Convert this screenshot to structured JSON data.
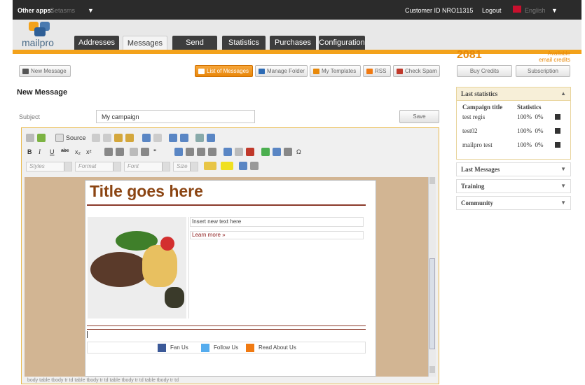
{
  "topbar": {
    "other_apps_label": "Other apps:",
    "other_apps_value": "Getasms",
    "customer_id": "Customer ID NRO11315",
    "logout": "Logout",
    "language": "English"
  },
  "logo": {
    "text": "mailpro"
  },
  "tabs": [
    {
      "label": "Addresses"
    },
    {
      "label": "Messages"
    },
    {
      "label": "Send"
    },
    {
      "label": "Statistics"
    },
    {
      "label": "Purchases"
    },
    {
      "label": "Configuration"
    }
  ],
  "toolbar": {
    "new_message": "New Message",
    "list_of_messages": "List of Messages",
    "manage_folder": "Manage Folder",
    "my_templates": "My Templates",
    "rss": "RSS",
    "check_spam": "Check Spam"
  },
  "credits": {
    "value": "2081",
    "label_line1": "Available",
    "label_line2": "email credits",
    "buy": "Buy Credits",
    "subscription": "Subscription"
  },
  "form": {
    "section_title": "New Message",
    "subject_label": "Subject",
    "subject_value": "My campaign",
    "save": "Save"
  },
  "editor": {
    "source_label": "Source",
    "styles": "Styles",
    "format": "Format",
    "font": "Font",
    "size": "Size",
    "template": {
      "title": "Title goes here",
      "insert_text": "Insert new text here",
      "learn_more": "Learn more »",
      "fan_us": "Fan Us",
      "follow_us": "Follow Us",
      "read_about_us": "Read About Us"
    },
    "path": "body  table  tbody  tr  td  table  tbody  tr  td  table  tbody  tr  td  table  tbody  tr  td"
  },
  "sidebar": {
    "last_statistics": "Last statistics",
    "col_campaign": "Campaign title",
    "col_statistics": "Statistics",
    "rows": [
      {
        "title": "test regis",
        "stats": "100%  0%"
      },
      {
        "title": "test02",
        "stats": "100%  0%"
      },
      {
        "title": "mailpro test",
        "stats": "100%  0%"
      }
    ],
    "last_messages": "Last Messages",
    "training": "Training",
    "community": "Community"
  },
  "colors": {
    "accent": "#f3a21b",
    "credits": "#e8890a",
    "title_brown": "#8b4513",
    "dark_bar": "#2b2b2b"
  }
}
